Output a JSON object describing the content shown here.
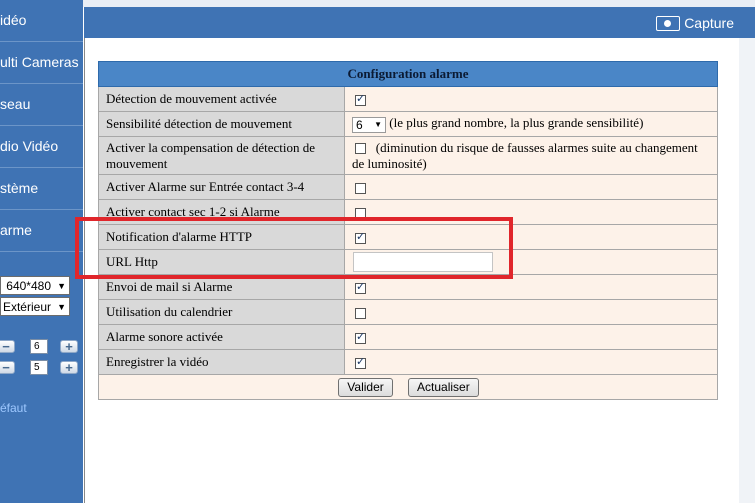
{
  "sidebar": {
    "items": [
      {
        "label": "idéo"
      },
      {
        "label": "ulti Cameras"
      },
      {
        "label": "seau"
      },
      {
        "label": "dio Vidéo"
      },
      {
        "label": "stème"
      },
      {
        "label": "arme"
      }
    ],
    "resolution": "640*480",
    "mode": "Extérieur",
    "stepper1_value": "6",
    "stepper2_value": "5",
    "default_link": "éfaut"
  },
  "header": {
    "capture_label": "Capture"
  },
  "config": {
    "title": "Configuration alarme",
    "rows": [
      {
        "label": "Détection de mouvement activée",
        "checked": true
      },
      {
        "label": "Sensibilité détection de mouvement",
        "select_value": "6",
        "note": "(le plus grand nombre, la plus grande sensibilité)"
      },
      {
        "label": "Activer la compensation de détection de mouvement",
        "checked": false,
        "note": "(diminution du risque de fausses alarmes suite au changement de luminosité)"
      },
      {
        "label": "Activer Alarme sur Entrée contact 3-4",
        "checked": false
      },
      {
        "label": "Activer contact sec 1-2 si Alarme",
        "checked": false
      },
      {
        "label": "Notification d'alarme HTTP",
        "checked": true
      },
      {
        "label": "URL Http",
        "value": ""
      },
      {
        "label": "Envoi de mail si Alarme",
        "checked": true
      },
      {
        "label": "Utilisation du calendrier",
        "checked": false
      },
      {
        "label": "Alarme sonore activée",
        "checked": true
      },
      {
        "label": "Enregistrer la vidéo",
        "checked": true
      }
    ],
    "submit_label": "Valider",
    "refresh_label": "Actualiser"
  },
  "colors": {
    "sidebar_blue": "#3f73b4",
    "table_header": "#4a86c7",
    "label_bg": "#d9d9d9",
    "value_bg": "#fdf2e9",
    "highlight_red": "#e0262b"
  }
}
